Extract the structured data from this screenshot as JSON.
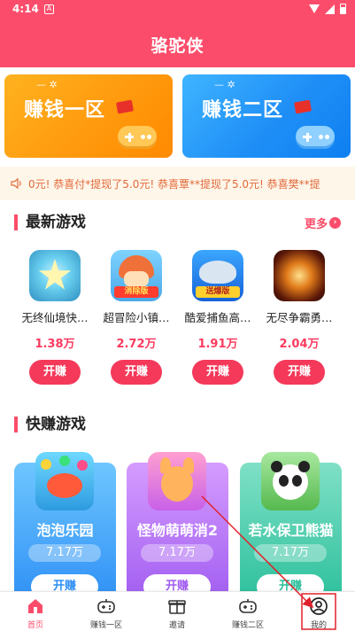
{
  "status_bar": {
    "time": "4:14",
    "notif_letter": "A"
  },
  "header": {
    "title": "骆驼侠"
  },
  "banners": [
    {
      "label": "赚钱一区"
    },
    {
      "label": "赚钱二区"
    }
  ],
  "ticker": {
    "text": "0元!  恭喜付*提现了5.0元!  恭喜覃**提现了5.0元!  恭喜樊**提"
  },
  "latest": {
    "title": "最新游戏",
    "more_label": "更多",
    "games": [
      {
        "name": "无终仙境快…",
        "count": "1.38万",
        "button": "开赚"
      },
      {
        "name": "超冒险小镇…",
        "count": "2.72万",
        "button": "开赚",
        "badge": "消除版"
      },
      {
        "name": "酷爱捕鱼高…",
        "count": "1.91万",
        "button": "开赚",
        "badge": "送爆版"
      },
      {
        "name": "无尽争霸勇…",
        "count": "2.04万",
        "button": "开赚"
      }
    ]
  },
  "quick": {
    "title": "快赚游戏",
    "games": [
      {
        "name": "泡泡乐园",
        "count": "7.17万",
        "button": "开赚"
      },
      {
        "name": "怪物萌萌消2",
        "count": "7.17万",
        "button": "开赚"
      },
      {
        "name": "若水保卫熊猫",
        "count": "7.17万",
        "button": "开赚"
      }
    ]
  },
  "bottom_nav": {
    "items": [
      {
        "label": "首页",
        "icon": "home-icon"
      },
      {
        "label": "赚钱一区",
        "icon": "gamepad-icon"
      },
      {
        "label": "邀请",
        "icon": "gift-icon"
      },
      {
        "label": "赚钱二区",
        "icon": "gamepad-icon"
      },
      {
        "label": "我的",
        "icon": "profile-icon"
      }
    ],
    "active": "首页"
  },
  "colors": {
    "brand": "#fb4d6b",
    "accent_button": "#f4395a",
    "banner_orange": "#ff9a0e",
    "banner_blue": "#1f8ff7",
    "annotation_arrow": "#e0202a"
  }
}
